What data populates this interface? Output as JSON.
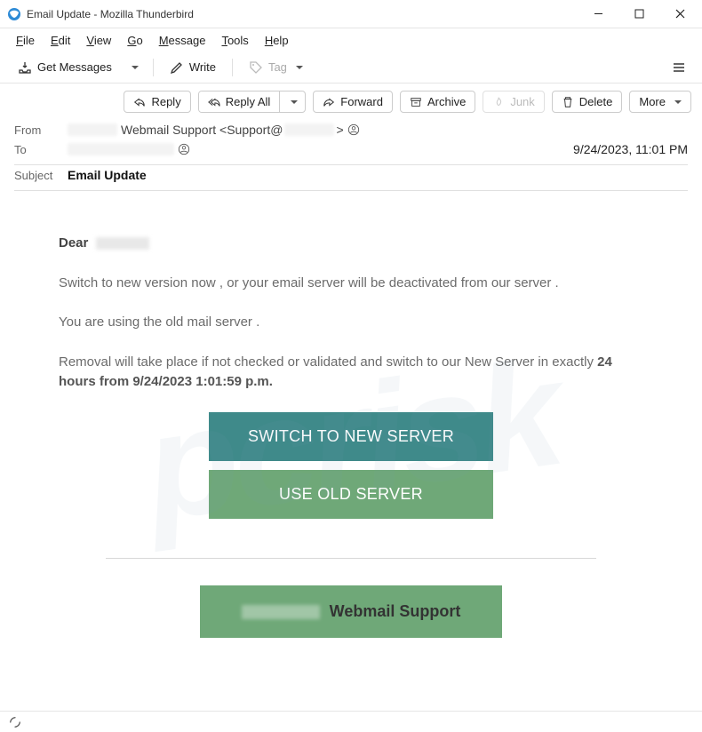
{
  "window": {
    "title": "Email Update - Mozilla Thunderbird"
  },
  "menu": {
    "file": "File",
    "edit": "Edit",
    "view": "View",
    "go": "Go",
    "message": "Message",
    "tools": "Tools",
    "help": "Help"
  },
  "toolbar": {
    "get_messages": "Get Messages",
    "write": "Write",
    "tag": "Tag"
  },
  "actions": {
    "reply": "Reply",
    "reply_all": "Reply All",
    "forward": "Forward",
    "archive": "Archive",
    "junk": "Junk",
    "delete": "Delete",
    "more": "More"
  },
  "headers": {
    "from_label": "From",
    "from_visible": "Webmail Support <Support@",
    "from_tail": ">",
    "to_label": "To",
    "date": "9/24/2023, 11:01 PM",
    "subject_label": "Subject",
    "subject_value": "Email Update"
  },
  "body": {
    "greeting_prefix": "Dear",
    "p1": "Switch to new version now  , or your email server will be deactivated from our server .",
    "p2": "You  are using the old  mail server .",
    "p3a": "Removal will take place if not checked or validated and switch to our New Server in exactly ",
    "p3b_bold": "24 hours from 9/24/2023 1:01:59 p.m.",
    "btn_new": "SWITCH TO NEW SERVER",
    "btn_old": "USE OLD SERVER",
    "support_suffix": "Webmail Support"
  },
  "status": {
    "indicator": "activity"
  }
}
